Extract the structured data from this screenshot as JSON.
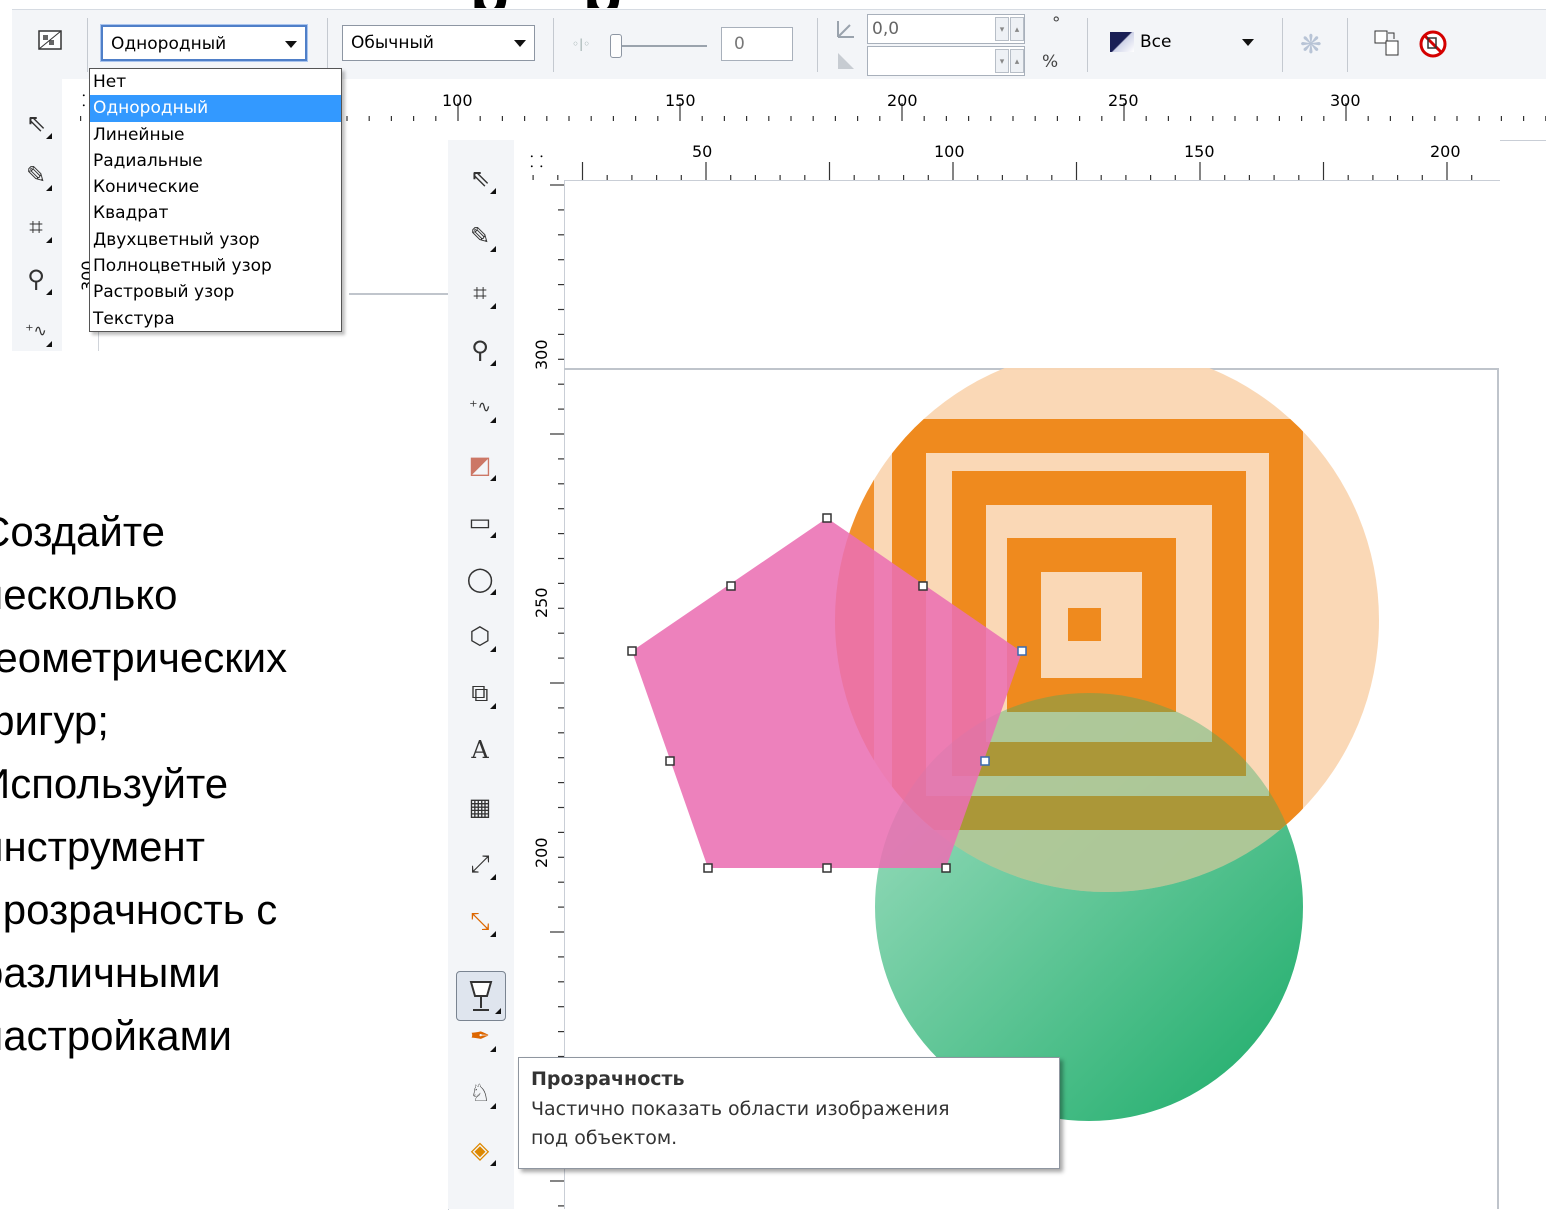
{
  "title_fragment": "р    р",
  "toolbar": {
    "fill_type_value": "Однородный",
    "merge_mode_value": "Обычный",
    "opacity_value": "0",
    "angle_value": "0,0",
    "degree_unit": "°",
    "percent_unit": "%",
    "target_value": "Все"
  },
  "fill_type_dropdown": {
    "items": [
      "Нет",
      "Однородный",
      "Линейные",
      "Радиальные",
      "Конические",
      "Квадрат",
      "Двухцветный узор",
      "Полноцветный узор",
      "Растровый узор",
      "Текстура"
    ],
    "selected_index": 1
  },
  "top_rulers": {
    "h_labels": [
      "100",
      "150",
      "200",
      "250",
      "300"
    ],
    "v_labels": [
      "300"
    ]
  },
  "main_rulers": {
    "h_labels": [
      "50",
      "100",
      "150",
      "200"
    ],
    "v_labels": [
      "300",
      "250",
      "200"
    ]
  },
  "bullets": [
    "Создайте\nнесколько\nгеометрических\nфигур;",
    "Используйте\nинструмент\nпрозрачность с\nразличными\nнастройками"
  ],
  "tooltip": {
    "title": "Прозрачность",
    "body_line1": "Частично показать области изображения",
    "body_line2": "под объектом."
  },
  "colors": {
    "pentagon": "#e975b6",
    "orange_circle_light": "#fad8b6",
    "orange_pattern": "#ef8a1e",
    "green_light": "#8ed7b4",
    "green_dark": "#22b070",
    "selection_blue": "#3399ff"
  },
  "icons": [
    "transparency-tool-icon",
    "pick-tool-icon",
    "shape-tool-icon",
    "crop-tool-icon",
    "zoom-tool-icon",
    "freehand-tool-icon",
    "smart-fill-icon",
    "rectangle-tool-icon",
    "ellipse-tool-icon",
    "polygon-tool-icon",
    "basic-shapes-icon",
    "text-tool-icon",
    "table-tool-icon",
    "dimension-tool-icon",
    "connector-tool-icon",
    "interactive-tool-icon",
    "eyedropper-tool-icon",
    "outline-tool-icon",
    "fill-tool-icon",
    "freeze-icon",
    "copy-transparency-icon",
    "clear-transparency-icon"
  ]
}
